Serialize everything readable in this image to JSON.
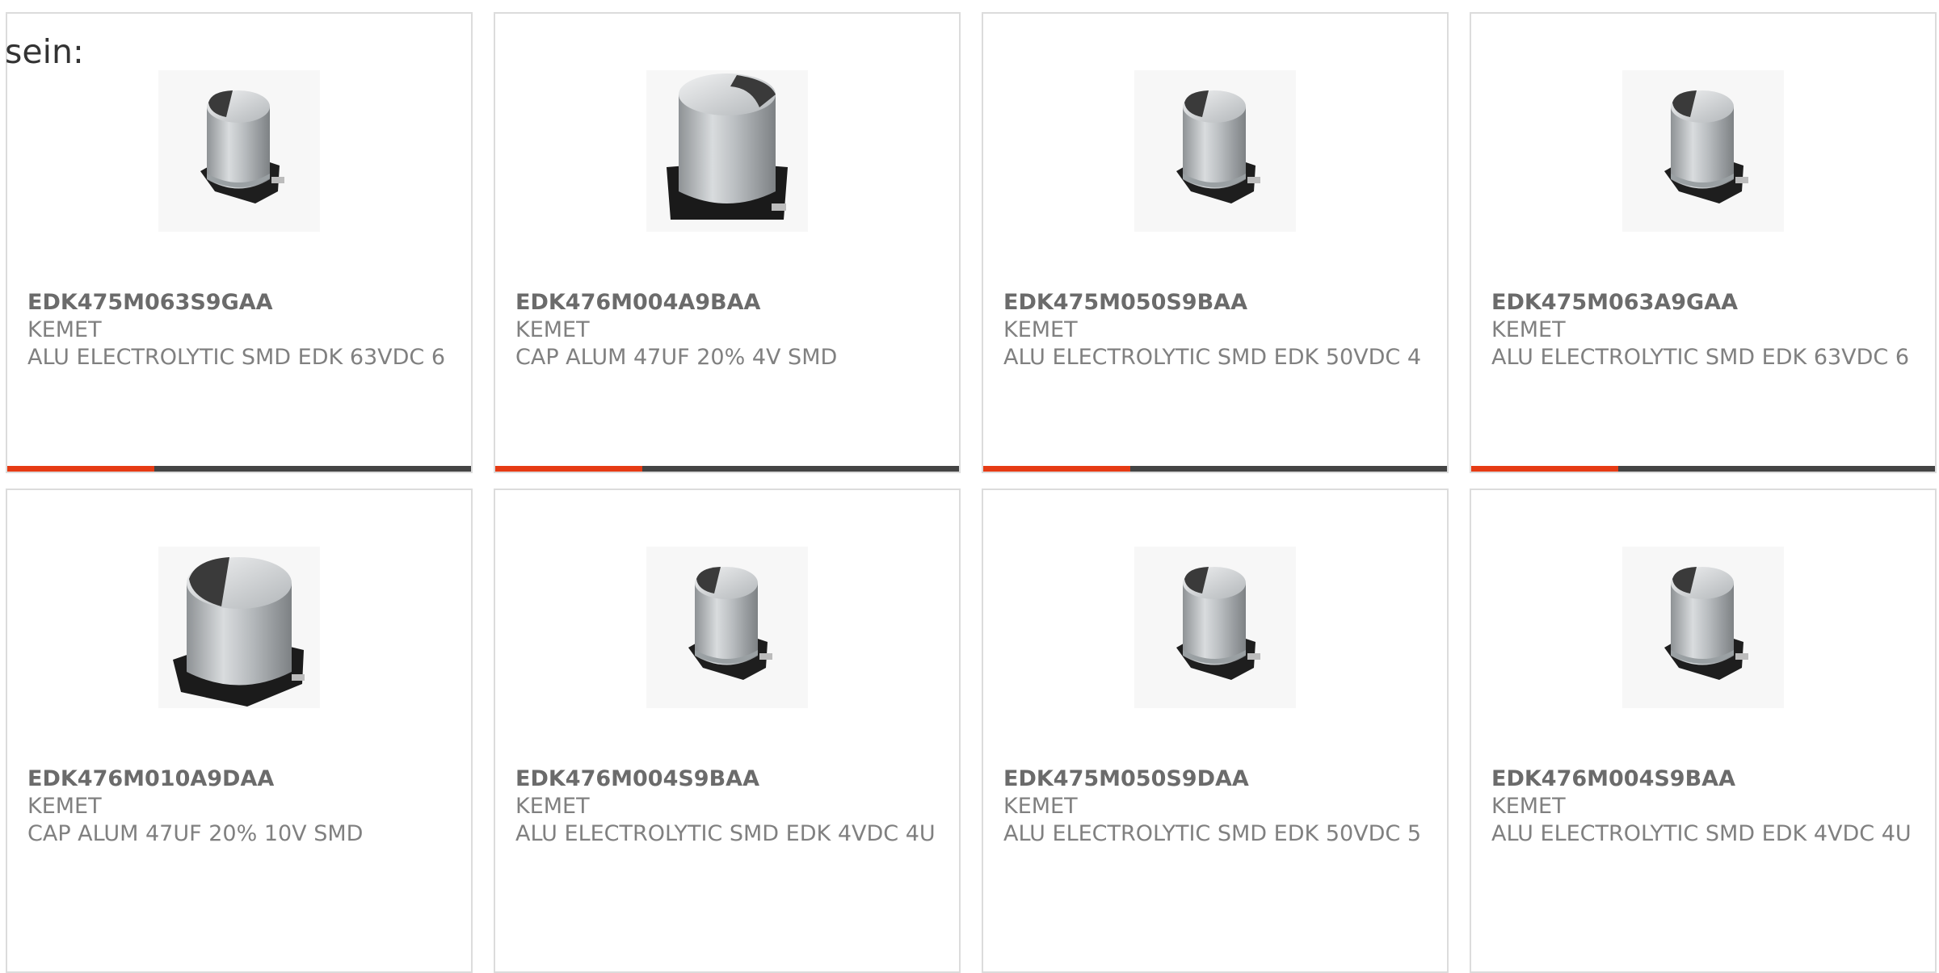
{
  "intro_text": "sein:",
  "colors": {
    "accent": "#e63b14",
    "bar": "#444444",
    "card_border": "#dcdcdc"
  },
  "products": [
    {
      "part_number": "EDK475M063S9GAA",
      "manufacturer": "KEMET",
      "description": "ALU ELECTROLYTIC SMD EDK 63VDC 6",
      "image_icon": "smd-capacitor-small",
      "has_accent_bar": true
    },
    {
      "part_number": "EDK476M004A9BAA",
      "manufacturer": "KEMET",
      "description": "CAP ALUM 47UF 20% 4V SMD",
      "image_icon": "smd-capacitor-large",
      "has_accent_bar": true
    },
    {
      "part_number": "EDK475M050S9BAA",
      "manufacturer": "KEMET",
      "description": "ALU ELECTROLYTIC SMD EDK 50VDC 4",
      "image_icon": "smd-capacitor-small",
      "has_accent_bar": true
    },
    {
      "part_number": "EDK475M063A9GAA",
      "manufacturer": "KEMET",
      "description": "ALU ELECTROLYTIC SMD EDK 63VDC 6",
      "image_icon": "smd-capacitor-small",
      "has_accent_bar": true
    },
    {
      "part_number": "EDK476M010A9DAA",
      "manufacturer": "KEMET",
      "description": "CAP ALUM 47UF 20% 10V SMD",
      "image_icon": "smd-capacitor-wide",
      "has_accent_bar": false
    },
    {
      "part_number": "EDK476M004S9BAA",
      "manufacturer": "KEMET",
      "description": "ALU ELECTROLYTIC SMD EDK 4VDC 4U",
      "image_icon": "smd-capacitor-small",
      "has_accent_bar": false
    },
    {
      "part_number": "EDK475M050S9DAA",
      "manufacturer": "KEMET",
      "description": "ALU ELECTROLYTIC SMD EDK 50VDC 5",
      "image_icon": "smd-capacitor-small",
      "has_accent_bar": false
    },
    {
      "part_number": "EDK476M004S9BAA",
      "manufacturer": "KEMET",
      "description": "ALU ELECTROLYTIC SMD EDK 4VDC 4U",
      "image_icon": "smd-capacitor-small",
      "has_accent_bar": false
    }
  ]
}
